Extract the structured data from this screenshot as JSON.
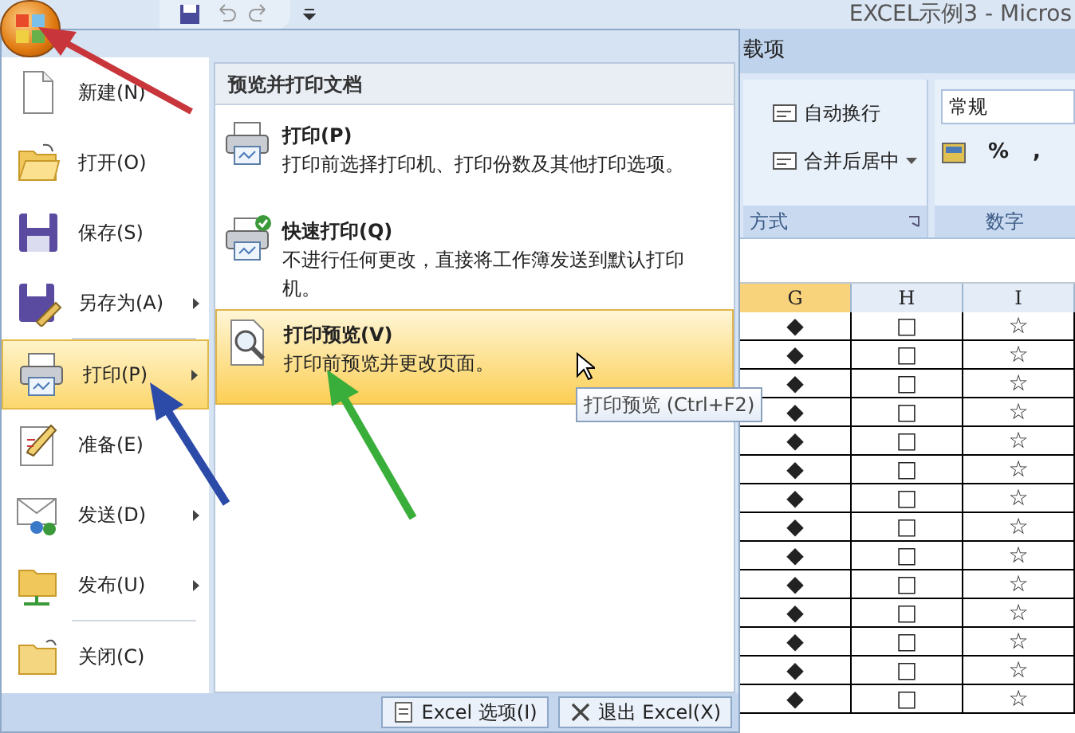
{
  "title_bar": {
    "title": "EXCEL示例3 - Micros"
  },
  "ribbon": {
    "tab_fragment": "载项",
    "alignment_group": {
      "buttons": [
        {
          "label": "自动换行",
          "dropdown": false
        },
        {
          "label": "合并后居中",
          "dropdown": true
        }
      ],
      "label": "方式"
    },
    "number_group": {
      "format": "常规",
      "buttons": [
        "%",
        ","
      ],
      "label": "数字"
    }
  },
  "sheet": {
    "columns": [
      {
        "label": "G",
        "selected": true
      },
      {
        "label": "H",
        "selected": false
      },
      {
        "label": "I",
        "selected": false
      }
    ],
    "rows": [
      [
        "◆",
        "□",
        "☆"
      ],
      [
        "◆",
        "□",
        "☆"
      ],
      [
        "◆",
        "□",
        "☆"
      ],
      [
        "◆",
        "□",
        "☆"
      ],
      [
        "◆",
        "□",
        "☆"
      ],
      [
        "◆",
        "□",
        "☆"
      ],
      [
        "◆",
        "□",
        "☆"
      ],
      [
        "◆",
        "□",
        "☆"
      ],
      [
        "◆",
        "□",
        "☆"
      ],
      [
        "◆",
        "□",
        "☆"
      ],
      [
        "◆",
        "□",
        "☆"
      ],
      [
        "◆",
        "□",
        "☆"
      ],
      [
        "◆",
        "□",
        "☆"
      ],
      [
        "◆",
        "□",
        "☆"
      ]
    ]
  },
  "office_menu": {
    "items": [
      {
        "kind": "new",
        "label": "新建(N)",
        "submenu": false,
        "selected": false,
        "divider_before": false
      },
      {
        "kind": "open",
        "label": "打开(O)",
        "submenu": false,
        "selected": false,
        "divider_before": false
      },
      {
        "kind": "save",
        "label": "保存(S)",
        "submenu": false,
        "selected": false,
        "divider_before": false
      },
      {
        "kind": "saveas",
        "label": "另存为(A)",
        "submenu": true,
        "selected": false,
        "divider_before": false
      },
      {
        "kind": "print",
        "label": "打印(P)",
        "submenu": true,
        "selected": true,
        "divider_before": true
      },
      {
        "kind": "prepare",
        "label": "准备(E)",
        "submenu": false,
        "selected": false,
        "divider_before": false
      },
      {
        "kind": "send",
        "label": "发送(D)",
        "submenu": true,
        "selected": false,
        "divider_before": false
      },
      {
        "kind": "publish",
        "label": "发布(U)",
        "submenu": true,
        "selected": false,
        "divider_before": false
      },
      {
        "kind": "close",
        "label": "关闭(C)",
        "submenu": false,
        "selected": false,
        "divider_before": true
      }
    ],
    "panel": {
      "heading": "预览并打印文档",
      "items": [
        {
          "kind": "print",
          "title": "打印(P)",
          "description": "打印前选择打印机、打印份数及其他打印选项。",
          "selected": false
        },
        {
          "kind": "quickprint",
          "title": "快速打印(Q)",
          "description": "不进行任何更改，直接将工作簿发送到默认打印机。",
          "selected": false
        },
        {
          "kind": "preview",
          "title": "打印预览(V)",
          "description": "打印前预览并更改页面。",
          "selected": true
        }
      ]
    },
    "footer_buttons": [
      {
        "kind": "options",
        "label": "Excel 选项(I)"
      },
      {
        "kind": "exit",
        "label": "退出 Excel(X)"
      }
    ]
  },
  "tooltip": "打印预览 (Ctrl+F2)"
}
